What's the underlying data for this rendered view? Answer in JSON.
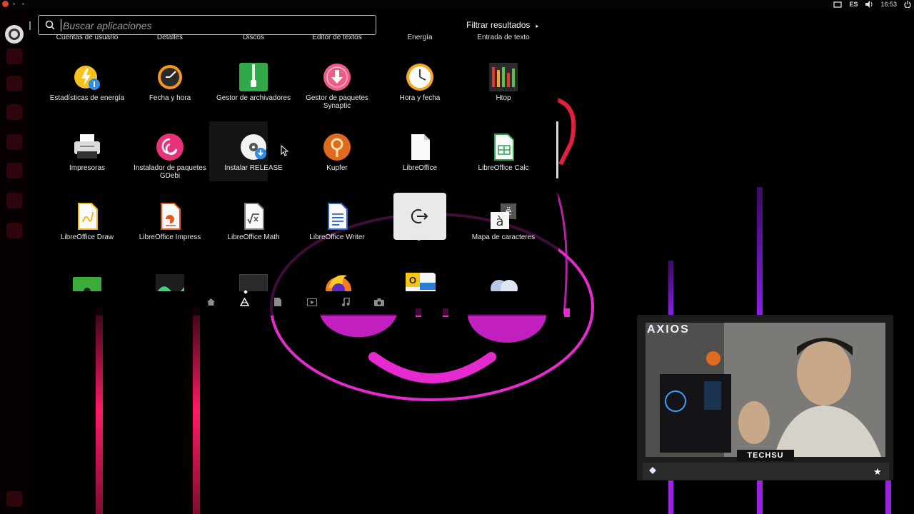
{
  "top_panel": {
    "language": "ES",
    "time": "16:53",
    "icons": [
      "screen-icon",
      "keyboard-lang-icon",
      "volume-icon",
      "power-icon"
    ]
  },
  "launcher": {
    "icons": [
      "ubuntu-home-icon",
      "app-icon-1",
      "app-icon-2",
      "app-icon-3",
      "app-icon-4",
      "app-icon-5",
      "app-icon-6",
      "app-icon-7",
      "trash-icon"
    ]
  },
  "search": {
    "placeholder": "Buscar aplicaciones",
    "value": ""
  },
  "filter_results": {
    "label": "Filtrar resultados",
    "arrow": "▸"
  },
  "cut_labels": [
    "Cuentas de usuario",
    "Detalles",
    "Discos",
    "Editor de textos",
    "Energía",
    "Entrada de texto"
  ],
  "apps": [
    {
      "label": "Estadísticas de energía",
      "icon": "energy-stats-icon"
    },
    {
      "label": "Fecha y hora",
      "icon": "clock-settings-icon"
    },
    {
      "label": "Gestor de archivadores",
      "icon": "archive-zip-icon"
    },
    {
      "label": "Gestor de paquetes Synaptic",
      "icon": "synaptic-icon"
    },
    {
      "label": "Hora y fecha",
      "icon": "clock-icon"
    },
    {
      "label": "Htop",
      "icon": "htop-icon"
    },
    {
      "label": "Impresoras",
      "icon": "printer-icon"
    },
    {
      "label": "Instalador de paquetes GDebi",
      "icon": "debian-swirl-icon"
    },
    {
      "label": "Instalar RELEASE",
      "icon": "install-disc-icon"
    },
    {
      "label": "Kupfer",
      "icon": "kupfer-icon"
    },
    {
      "label": "LibreOffice",
      "icon": "libreoffice-icon"
    },
    {
      "label": "LibreOffice Calc",
      "icon": "libreoffice-calc-icon"
    },
    {
      "label": "LibreOffice Draw",
      "icon": "libreoffice-draw-icon"
    },
    {
      "label": "LibreOffice Impress",
      "icon": "libreoffice-impress-icon"
    },
    {
      "label": "LibreOffice Math",
      "icon": "libreoffice-math-icon"
    },
    {
      "label": "LibreOffice Writer",
      "icon": "libreoffice-writer-icon"
    },
    {
      "label": "Logout",
      "icon": "logout-icon"
    },
    {
      "label": "Mapa de caracteres",
      "icon": "character-map-icon"
    }
  ],
  "partial_row_icons": [
    "hardware-card-icon",
    "monitor-app-icon",
    "dark-window-icon",
    "firefox-icon",
    "outlook-mail-icon",
    "network-globe-icon"
  ],
  "lenses": [
    "home-lens-icon",
    "applications-lens-icon",
    "files-lens-icon",
    "video-lens-icon",
    "music-lens-icon",
    "photo-lens-icon"
  ],
  "colors": {
    "accent_magenta": "#e52bd0",
    "accent_pink": "#ff1a5e",
    "dash_bg": "#000000",
    "text": "#e8e8e8"
  },
  "webcam": {
    "brand": "AXIOS",
    "logo": "TECHSU"
  }
}
